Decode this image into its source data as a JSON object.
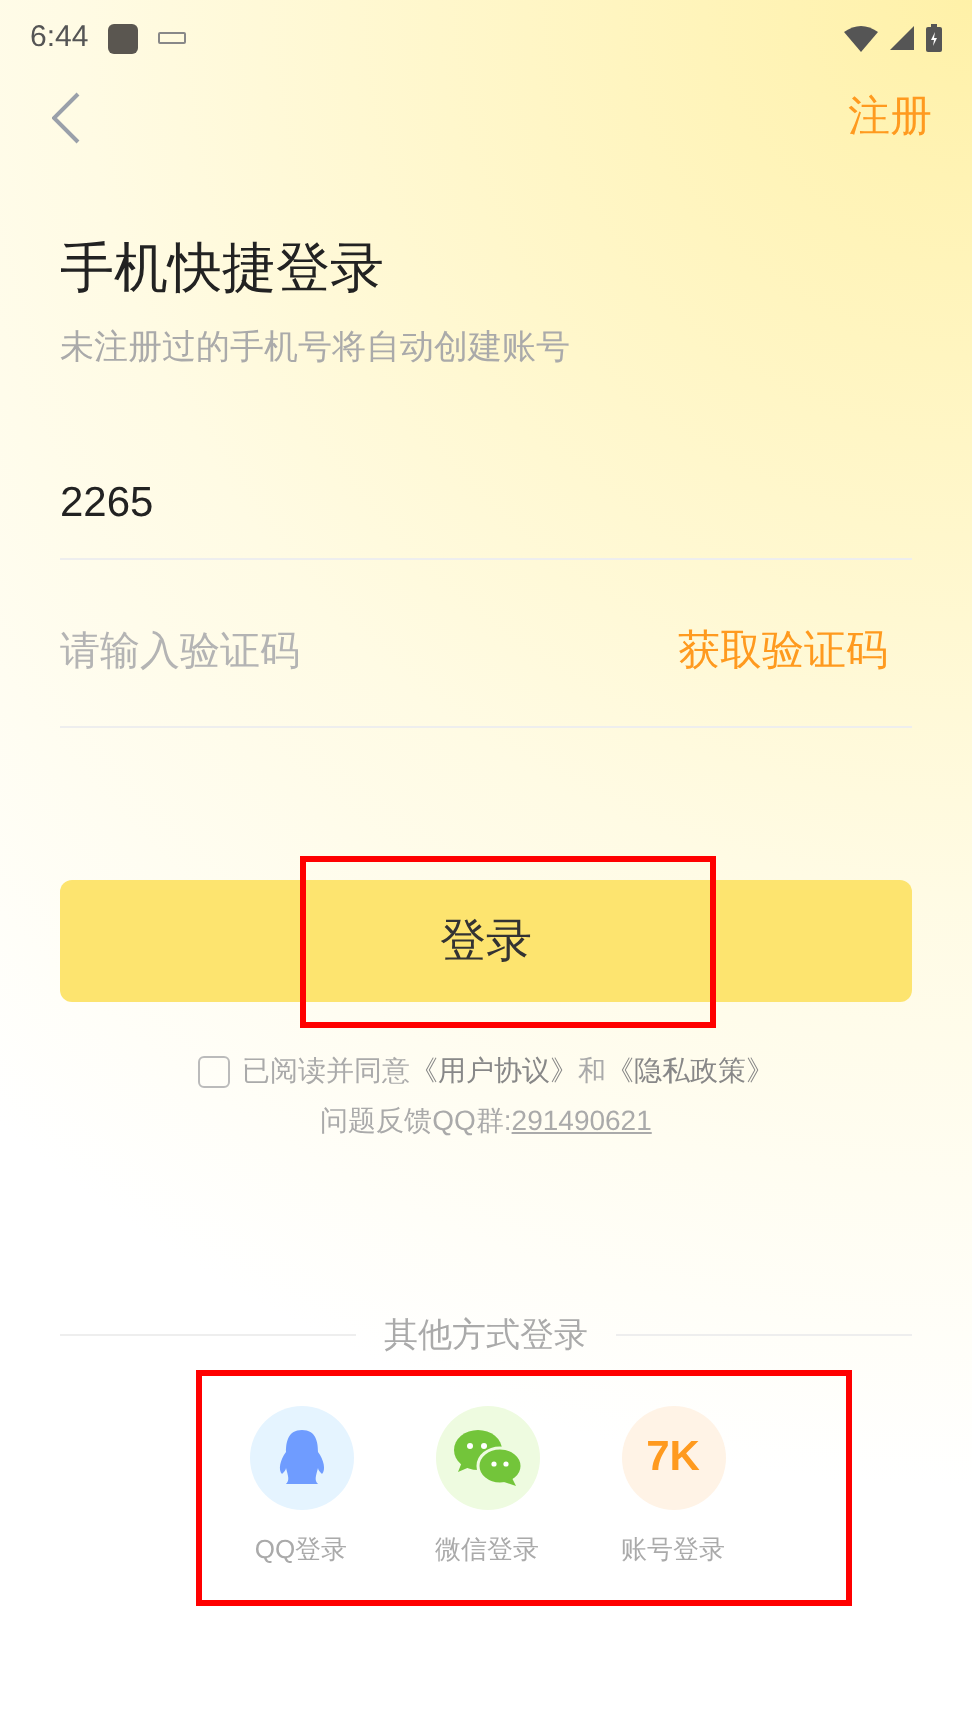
{
  "status_bar": {
    "time": "6:44"
  },
  "header": {
    "action": "注册"
  },
  "title": "手机快捷登录",
  "subtitle": "未注册过的手机号将自动创建账号",
  "phone_field": {
    "value": "2265"
  },
  "code_field": {
    "placeholder": "请输入验证码",
    "action": "获取验证码"
  },
  "login_button": {
    "label": "登录",
    "highlighted": true
  },
  "agreement": {
    "checked": false,
    "text": "已阅读并同意",
    "links": [
      "《用户协议》",
      "《隐私政策》"
    ],
    "joiner": "和"
  },
  "feedback": {
    "label": "问题反馈QQ群:",
    "link": "291490621"
  },
  "other_logins": {
    "title": "其他方式登录",
    "highlighted": true,
    "items": [
      {
        "kind": "qq",
        "label": "QQ登录"
      },
      {
        "kind": "wechat",
        "label": "微信登录"
      },
      {
        "kind": "account",
        "label": "账号登录",
        "icon_text": "7K"
      }
    ]
  }
}
